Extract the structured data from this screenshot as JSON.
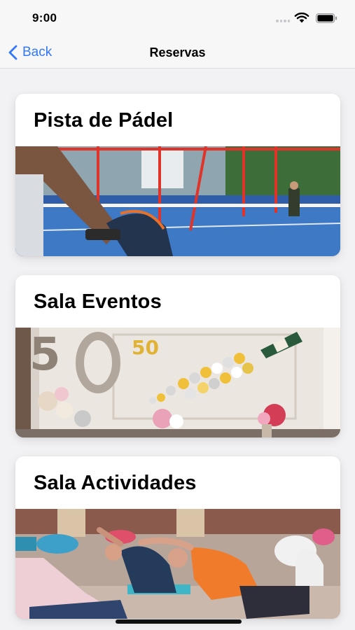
{
  "status_bar": {
    "time": "9:00"
  },
  "nav": {
    "back_label": "Back",
    "title": "Reservas"
  },
  "cards": [
    {
      "title": "Pista de Pádel",
      "image": "padel-court-photo"
    },
    {
      "title": "Sala Eventos",
      "image": "party-room-balloons-photo"
    },
    {
      "title": "Sala Actividades",
      "image": "yoga-class-photo"
    }
  ],
  "colors": {
    "accent": "#3478f6",
    "background": "#f2f2f4",
    "card": "#ffffff"
  }
}
